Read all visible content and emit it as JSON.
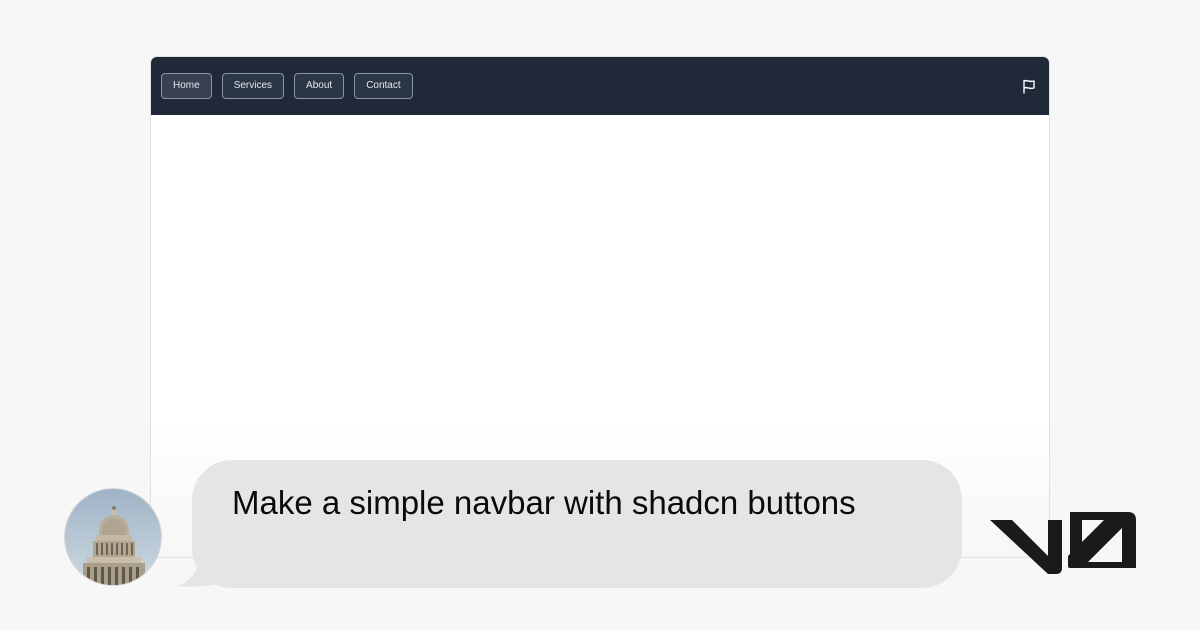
{
  "navbar": {
    "items": [
      {
        "label": "Home"
      },
      {
        "label": "Services"
      },
      {
        "label": "About"
      },
      {
        "label": "Contact"
      }
    ],
    "right_icon": "flag-icon",
    "background_color": "#1f2937"
  },
  "chat": {
    "message": "Make a simple navbar with shadcn buttons",
    "avatar_icon": "capitol-dome-photo",
    "bubble_color": "#e5e5e7"
  },
  "brand": {
    "logo_icon": "v0-logo"
  }
}
